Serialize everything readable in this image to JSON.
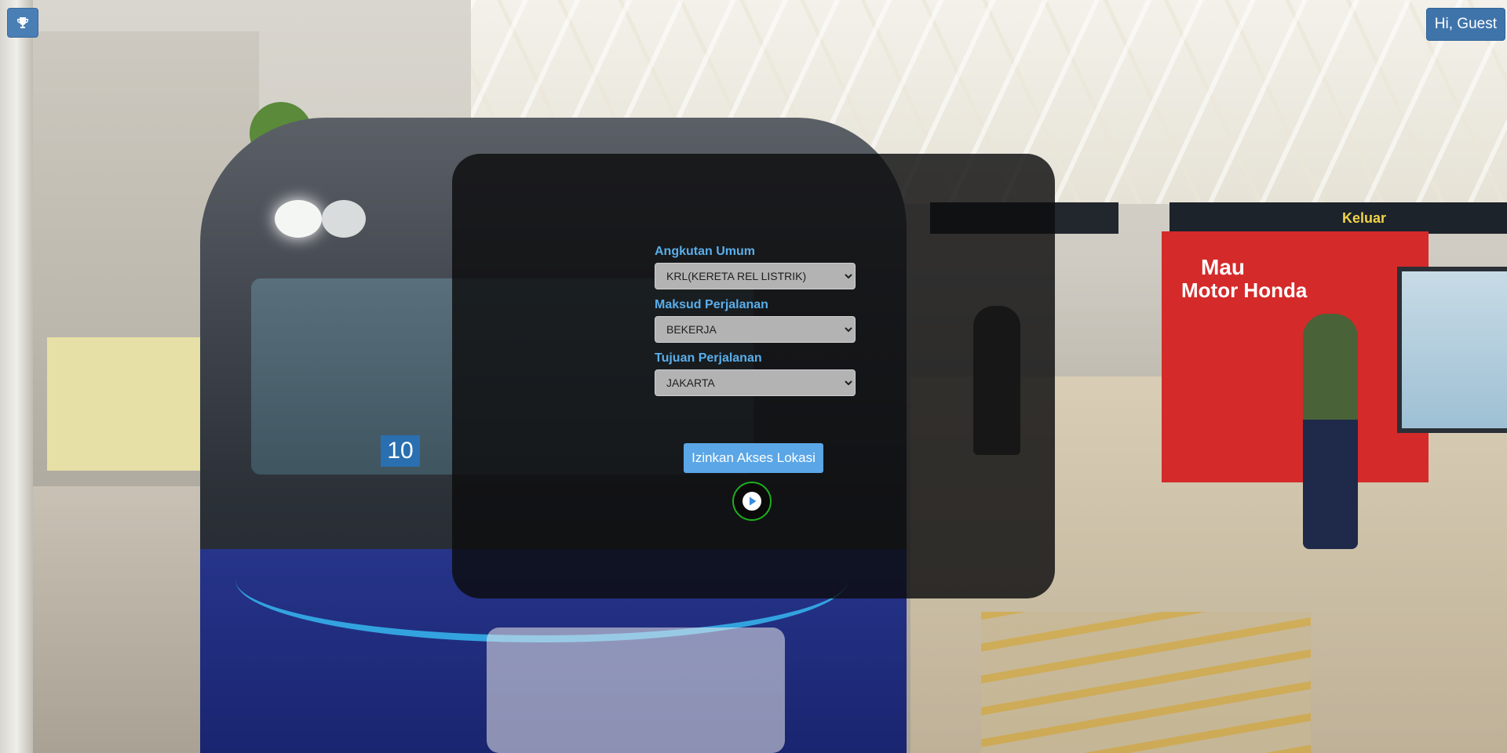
{
  "topbar": {
    "trophy_icon": "trophy-icon",
    "greeting": "Hi, Guest"
  },
  "form": {
    "transport": {
      "label": "Angkutan Umum",
      "value": "KRL(KERETA REL LISTRIK)"
    },
    "purpose": {
      "label": "Maksud Perjalanan",
      "value": "BEKERJA"
    },
    "destination": {
      "label": "Tujuan Perjalanan",
      "value": "JAKARTA"
    }
  },
  "actions": {
    "location_button": "Izinkan Akses Lokasi",
    "play_icon": "play-icon"
  },
  "background": {
    "train_number": "10",
    "ad_line1": "Mau",
    "ad_line2": "Motor Honda",
    "exit_sign": "Keluar"
  },
  "colors": {
    "label_blue": "#5aaeea",
    "button_blue": "#5aa6e6",
    "play_ring": "#1cb01c",
    "panel_bg": "rgba(12,12,14,0.82)"
  }
}
